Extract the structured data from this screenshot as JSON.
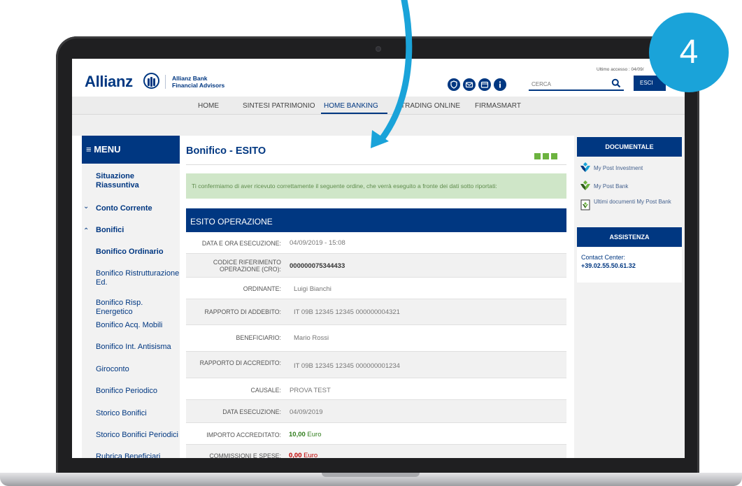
{
  "step_badge": "4",
  "header": {
    "logo_text": "Allianz",
    "sub_brand_line1": "Allianz Bank",
    "sub_brand_line2": "Financial Advisors",
    "search_placeholder": "CERCA",
    "last_access": "Ultimo accesso : 04/09/",
    "exit_label": "ESCI"
  },
  "nav": {
    "items": [
      "HOME",
      "SINTESI PATRIMONIO",
      "HOME BANKING",
      "TRADING ONLINE",
      "FIRMASMART"
    ],
    "active": "HOME BANKING"
  },
  "menu": {
    "title": "MENU",
    "summary_line1": "Situazione",
    "summary_line2": "Riassuntiva",
    "section_conto": "Conto Corrente",
    "section_bonifici": "Bonifici",
    "items": [
      "Bonifico Ordinario",
      "Bonifico Ristrutturazione Ed.",
      "Bonifico Risp. Energetico",
      "Bonifico Acq. Mobili",
      "Bonifico Int. Antisisma",
      "Giroconto",
      "Bonifico Periodico",
      "Storico Bonifici",
      "Storico Bonifici Periodici",
      "Rubrica Beneficiari"
    ]
  },
  "main": {
    "title": "Bonifico - ESITO",
    "confirmation": "Ti confermiamo di aver ricevuto correttamente il seguente ordine, che verrà eseguito a fronte dei dati sotto riportati:",
    "esito_title": "ESITO OPERAZIONE",
    "rows": [
      {
        "label": "DATA E ORA ESECUZIONE:",
        "value": "04/09/2019 - 15:08"
      },
      {
        "label_line1": "CODICE RIFERIMENTO",
        "label_line2": "OPERAZIONE (CRO):",
        "value": "000000075344433"
      },
      {
        "label": "ORDINANTE:",
        "value": "Luigi Bianchi"
      },
      {
        "label": "RAPPORTO DI ADDEBITO:",
        "value": "IT 09B 12345 12345 000000004321"
      },
      {
        "label": "BENEFICIARIO:",
        "value": "Mario Rossi"
      },
      {
        "label": "RAPPORTO DI ACCREDITO:",
        "value": "IT 09B 12345 12345 000000001234"
      },
      {
        "label": "CAUSALE:",
        "value": "PROVA TEST"
      },
      {
        "label": "DATA ESECUZIONE:",
        "value": "04/09/2019"
      },
      {
        "label": "IMPORTO ACCREDITATO:",
        "amount": "10,00",
        "unit": "Euro"
      },
      {
        "label": "COMMISSIONI E SPESE:",
        "amount": "0,00",
        "unit": "Euro"
      }
    ]
  },
  "right": {
    "documentale_title": "DOCUMENTALE",
    "doc_items": [
      "My Post Investment",
      "My Post Bank",
      "Ultimi documenti My Post Bank"
    ],
    "assistenza_title": "ASSISTENZA",
    "contact_label": "Contact Center:",
    "contact_phone": "+39.02.55.50.61.32"
  },
  "colors": {
    "brand_blue": "#003781",
    "accent_cyan": "#1aa3d9",
    "success_bg": "#cfe6c8",
    "success_green": "#6cb33f",
    "amount_green": "#2f7d1b",
    "amount_red": "#c00000"
  }
}
